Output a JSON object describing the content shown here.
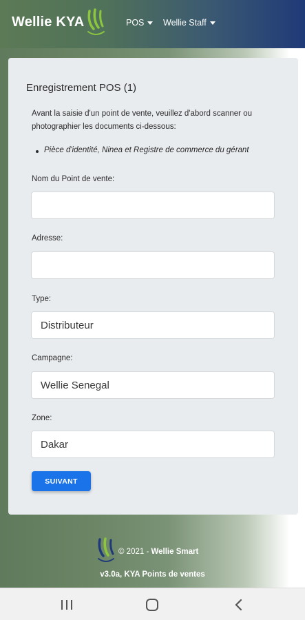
{
  "header": {
    "brand": "Wellie KYA",
    "nav": [
      {
        "label": "POS"
      },
      {
        "label": "Wellie Staff"
      }
    ]
  },
  "form": {
    "title": "Enregistrement POS (1)",
    "intro": "Avant la saisie d'un point de vente, veuillez d'abord scanner ou photographier les documents ci-dessous:",
    "documents": [
      "Pièce d'identité, Ninea et Registre de commerce du gérant"
    ],
    "fields": {
      "name": {
        "label": "Nom du Point de vente:",
        "value": ""
      },
      "address": {
        "label": "Adresse:",
        "value": ""
      },
      "type": {
        "label": "Type:",
        "value": "Distributeur"
      },
      "campaign": {
        "label": "Campagne:",
        "value": "Wellie Senegal"
      },
      "zone": {
        "label": "Zone:",
        "value": "Dakar"
      }
    },
    "submit_label": "SUIVANT"
  },
  "footer": {
    "copyright_prefix": "© 2021 - ",
    "company": "Wellie Smart",
    "version": "v3.0a, KYA Points de ventes"
  },
  "icons": {
    "brand_logo": "wellie-leaf-logo",
    "recent_apps": "recent-apps-icon",
    "home": "home-icon",
    "back": "back-icon"
  },
  "colors": {
    "header_start": "#5c7a55",
    "header_end": "#1f3a78",
    "primary_button": "#1a73e8",
    "logo_green": "#8cc63f",
    "logo_blue": "#1f3a78"
  }
}
